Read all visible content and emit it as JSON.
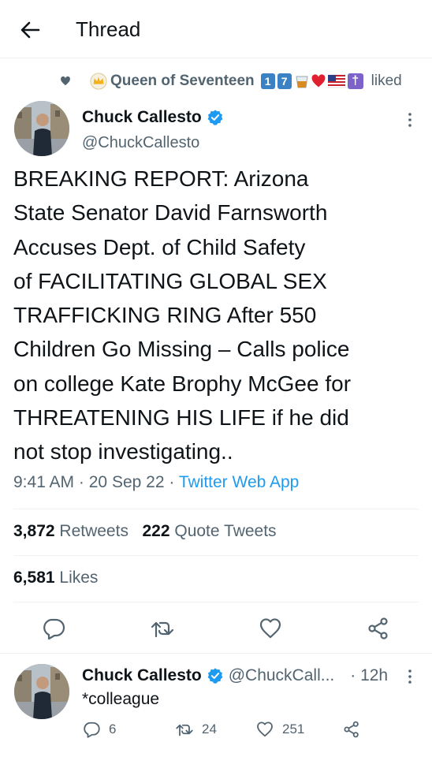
{
  "header": {
    "title": "Thread"
  },
  "liked_by": {
    "name": "Queen of Seventeen",
    "emoji_digits": [
      "1",
      "7"
    ],
    "cross": "†",
    "suffix": "liked"
  },
  "tweet": {
    "author_name": "Chuck Callesto",
    "author_handle": "@ChuckCallesto",
    "text": "BREAKING REPORT: Arizona\nState Senator David Farnsworth\nAccuses Dept. of Child Safety\nof FACILITATING GLOBAL SEX\nTRAFFICKING RING After 550\nChildren Go Missing – Calls police\non college Kate Brophy McGee for\nTHREATENING HIS LIFE if he did\nnot stop investigating..",
    "time": "9:41 AM",
    "date": "20 Sep 22",
    "separator": "·",
    "app": "Twitter Web App",
    "retweets": "3,872",
    "retweets_label": "Retweets",
    "quotes": "222",
    "quotes_label": "Quote Tweets",
    "likes": "6,581",
    "likes_label": "Likes"
  },
  "reply": {
    "author_name": "Chuck Callesto",
    "author_handle": "@ChuckCall...",
    "time": "· 12h",
    "text": "*colleague",
    "replies": "6",
    "retweets": "24",
    "likes": "251"
  },
  "colors": {
    "accent": "#1d9bf0",
    "text": "#0f1419",
    "muted": "#536471",
    "divider": "#eff3f4"
  },
  "icons": [
    "back-arrow-icon",
    "heart-icon",
    "crown-icon",
    "verified-icon",
    "more-icon",
    "reply-icon",
    "retweet-icon",
    "like-icon",
    "share-icon"
  ]
}
